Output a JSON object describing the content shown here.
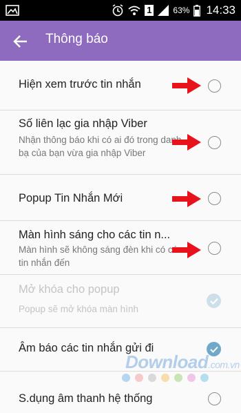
{
  "status_bar": {
    "sim_number": "1",
    "battery_text": "63%",
    "time": "14:33"
  },
  "app_bar": {
    "title": "Thông báo"
  },
  "settings": [
    {
      "title": "Hiện xem trước tin nhắn",
      "subtitle": "",
      "control": "radio",
      "checked": false,
      "enabled": true,
      "arrow": true
    },
    {
      "title": "Số liên lạc gia nhập Viber",
      "subtitle": "Nhận thông báo khi có ai đó trong danh bạ của bạn vừa gia nhập Viber",
      "control": "radio",
      "checked": false,
      "enabled": true,
      "arrow": true
    },
    {
      "title": "Popup Tin Nhắn Mới",
      "subtitle": "",
      "control": "radio",
      "checked": false,
      "enabled": true,
      "arrow": true
    },
    {
      "title": "Màn hình sáng cho các tin n...",
      "subtitle": "Màn hình sẽ không sáng đèn khi có các tin nhắn đến",
      "control": "radio",
      "checked": false,
      "enabled": true,
      "arrow": true
    },
    {
      "title": "Mở khóa cho popup",
      "subtitle": "Popup sẽ mở khóa màn hình",
      "control": "check",
      "checked": true,
      "enabled": false,
      "arrow": false
    },
    {
      "title": "Âm báo các tin nhắn gửi đi",
      "subtitle": "",
      "control": "check",
      "checked": true,
      "enabled": true,
      "arrow": false
    },
    {
      "title": "S.dụng âm thanh hệ thống",
      "subtitle": "",
      "control": "radio",
      "checked": false,
      "enabled": true,
      "arrow": false
    }
  ],
  "watermark": {
    "text": "Download",
    "suffix": ".com.vn",
    "dot_colors": [
      "#7db6e8",
      "#f2a3a3",
      "#bdbdbd",
      "#f5c36b",
      "#9ed37a",
      "#e59ad4",
      "#7cc9e6"
    ]
  },
  "colors": {
    "app_bar": "#8e6bbf",
    "checkbox": "#6fa8c9",
    "arrow": "#e8121c"
  }
}
